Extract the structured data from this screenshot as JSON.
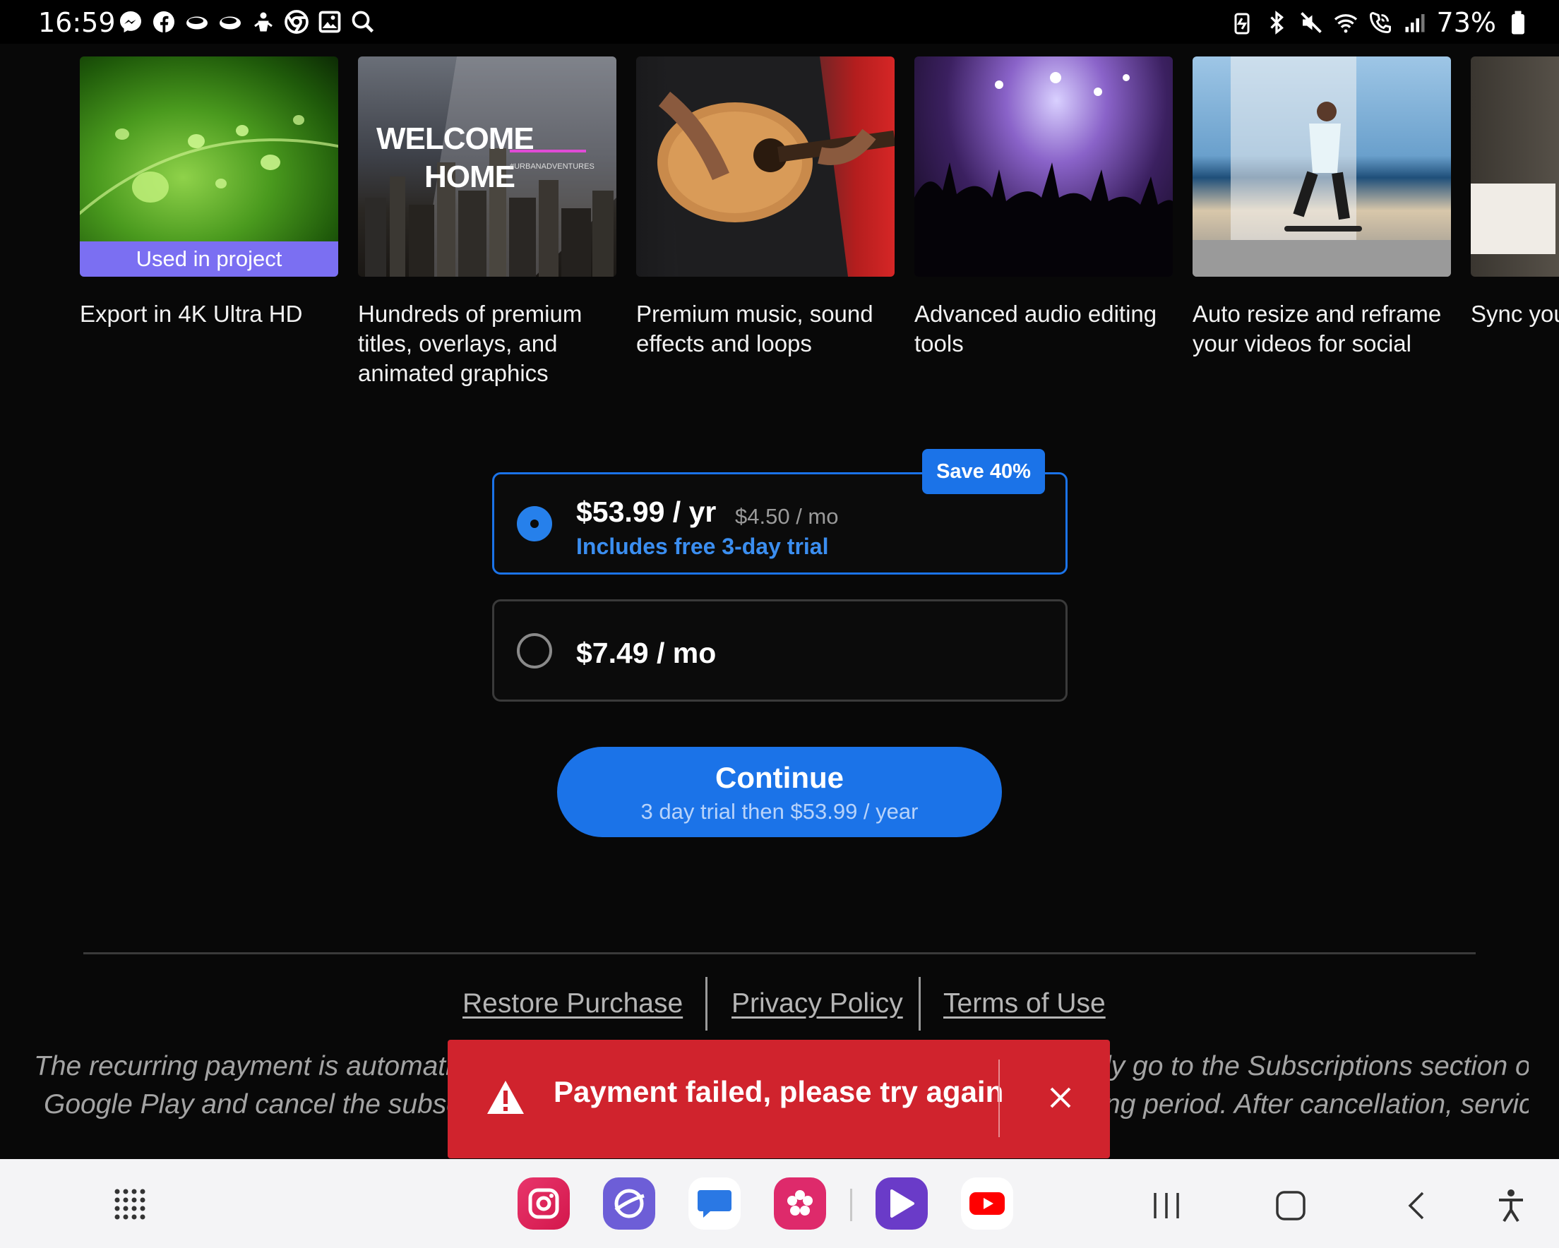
{
  "status_bar": {
    "time": "16:59",
    "left_icons": [
      "messenger-icon",
      "facebook-icon",
      "cloud-icon",
      "cloud-icon",
      "android-icon",
      "chrome-icon",
      "gallery-icon",
      "search-icon"
    ],
    "right_icons": [
      "battery-saver-icon",
      "bluetooth-icon",
      "mute-icon",
      "wifi-icon",
      "wifi-call-icon",
      "signal-icon"
    ],
    "battery": "73%"
  },
  "features": [
    {
      "caption": "Export in 4K Ultra HD",
      "badge": "Used in project",
      "thumbnail": "leaf-droplets-image"
    },
    {
      "caption": "Hundreds of premium titles, overlays, and animated graphics",
      "thumbnail": "city-skyline-image",
      "overlay_title_line1": "WELCOME",
      "overlay_title_line2": "HOME",
      "overlay_tag": "#URBANADVENTURES"
    },
    {
      "caption": "Premium music, sound effects and loops",
      "thumbnail": "guitar-player-image"
    },
    {
      "caption": "Advanced audio editing tools",
      "thumbnail": "concert-crowd-image"
    },
    {
      "caption": "Auto resize and reframe your videos for social",
      "thumbnail": "skateboarder-image"
    },
    {
      "caption": "Sync you edit on a",
      "thumbnail": "partial-image"
    }
  ],
  "plans": {
    "annual": {
      "price": "$53.99 / yr",
      "per_month": "$4.50 / mo",
      "trial": "Includes free 3-day trial",
      "badge": "Save 40%",
      "selected": true
    },
    "monthly": {
      "price": "$7.49 / mo",
      "selected": false
    }
  },
  "continue_button": {
    "title": "Continue",
    "subtitle": "3 day trial then $53.99 / year"
  },
  "footer": {
    "links": [
      "Restore Purchase",
      "Privacy Policy",
      "Terms of Use"
    ],
    "legal_left_line1": "The recurring payment is automatic",
    "legal_left_line2": "Google Play and cancel the subscri",
    "legal_right_line1": "ly go to the Subscriptions section on",
    "legal_right_line2": "ng period. After cancellation, service"
  },
  "toast": {
    "message": "Payment failed, please try again",
    "icon": "warning-icon",
    "close_icon": "close-icon"
  },
  "colors": {
    "accent": "#1b73e8",
    "error": "#d0232d",
    "badge_purple": "#7b6ff2",
    "background": "#080808"
  },
  "nav_bar": {
    "dock": [
      "instagram-icon",
      "samsung-internet-icon",
      "messages-icon",
      "blossom-icon",
      "video-player-icon",
      "youtube-icon"
    ],
    "buttons": [
      "recents-icon",
      "home-icon",
      "back-icon",
      "accessibility-icon"
    ]
  }
}
